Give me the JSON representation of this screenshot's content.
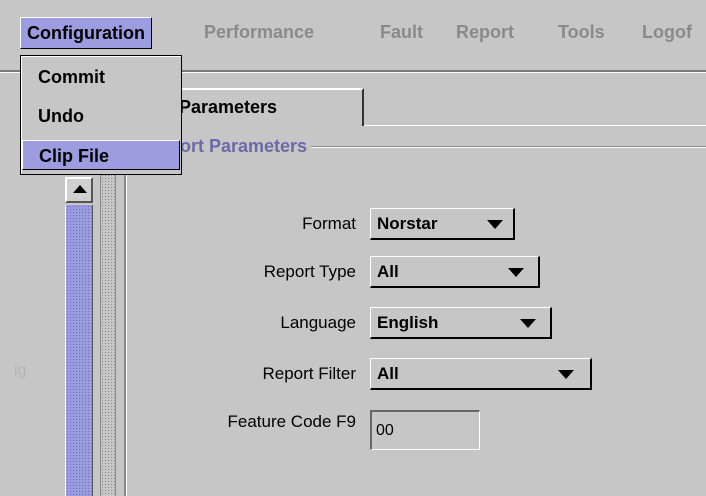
{
  "menubar": {
    "items": [
      {
        "label": "Configuration",
        "active": true
      },
      {
        "label": "Performance"
      },
      {
        "label": "Fault"
      },
      {
        "label": "Report"
      },
      {
        "label": "Tools"
      },
      {
        "label": "Logof"
      }
    ]
  },
  "dropdown": {
    "items": [
      {
        "label": "Commit"
      },
      {
        "label": "Undo"
      },
      {
        "label": "Clip File",
        "selected": true
      }
    ]
  },
  "left_panel": {
    "ghost_text": "ig"
  },
  "tab": {
    "label": "ort Parameters"
  },
  "group": {
    "title": "ort Parameters"
  },
  "form": {
    "format": {
      "label": "Format",
      "value": "Norstar"
    },
    "report_type": {
      "label": "Report Type",
      "value": "All"
    },
    "language": {
      "label": "Language",
      "value": "English"
    },
    "report_filter": {
      "label": "Report Filter",
      "value": "All"
    },
    "feature_code": {
      "label": "Feature Code F9",
      "value": "00"
    }
  },
  "colors": {
    "highlight": "#9c9ce0",
    "background": "#c6c6c6",
    "group_title": "#6a6aa8"
  }
}
